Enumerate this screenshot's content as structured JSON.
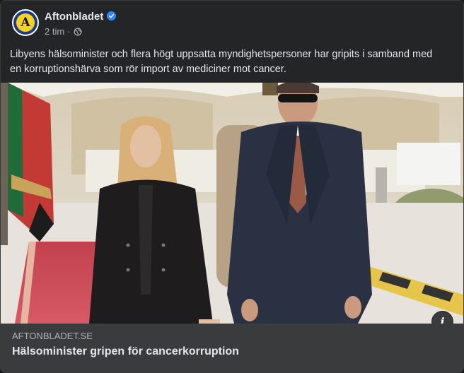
{
  "post": {
    "page_name": "Aftonbladet",
    "avatar_letter": "A",
    "verified_icon": "verified-badge-icon",
    "timestamp": "2 tim",
    "separator": "·",
    "audience_icon": "globe-icon",
    "text_line1": "Libyens hälsominister och flera högt uppsatta myndighetspersoner har gripits i samband med",
    "text_line2": "en korruptionshärva som rör import av mediciner mot cancer."
  },
  "link_preview": {
    "domain": "AFTONBLADET.SE",
    "title": "Hälsominister gripen för cancerkorruption",
    "info_icon": "info-icon",
    "info_glyph": "i"
  },
  "colors": {
    "card_background": "#242526",
    "preview_background": "#3a3b3c",
    "primary_text": "#e4e6eb",
    "secondary_text": "#b0b3b8",
    "verified_blue": "#2d88ff",
    "brand_yellow": "#f7d417",
    "brand_blue": "#1b3b8f"
  }
}
